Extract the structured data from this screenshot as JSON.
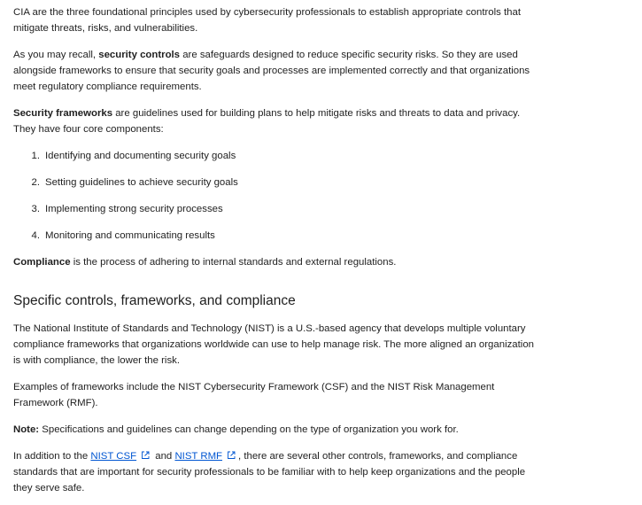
{
  "intro": {
    "text": "CIA are the three foundational principles used by cybersecurity professionals to establish appropriate controls that mitigate threats, risks, and vulnerabilities."
  },
  "controls": {
    "prefix": "As you may recall, ",
    "term": "security controls",
    "suffix": " are safeguards designed to reduce specific security risks. So they are used alongside frameworks to ensure that security goals and processes are implemented correctly and that organizations meet regulatory compliance requirements."
  },
  "frameworks": {
    "term": "Security frameworks",
    "suffix": " are guidelines used for building plans to help mitigate risks and threats to data and privacy. They have four core components:"
  },
  "core_components": [
    {
      "num": "1.",
      "text": "Identifying and documenting security goals"
    },
    {
      "num": "2.",
      "text": "Setting guidelines to achieve security goals"
    },
    {
      "num": "3.",
      "text": "Implementing strong security processes"
    },
    {
      "num": "4.",
      "text": "Monitoring and communicating results"
    }
  ],
  "compliance": {
    "term": "Compliance",
    "suffix": " is the process of adhering to internal standards and external regulations."
  },
  "section_heading": "Specific controls, frameworks, and compliance",
  "nist_paragraph": "The National Institute of Standards and Technology (NIST) is a U.S.-based agency that develops multiple voluntary compliance frameworks that organizations worldwide can use to help manage risk. The more aligned an organization is with compliance, the lower the risk.",
  "examples_paragraph": "Examples of frameworks include the NIST Cybersecurity Framework (CSF) and the NIST Risk Management Framework (RMF).",
  "note": {
    "label": "Note:",
    "text": " Specifications and guidelines can change depending on the type of organization you work for."
  },
  "addition": {
    "prefix": "In addition to the ",
    "link1": "NIST CSF",
    "middle": " and ",
    "link2": "NIST RMF",
    "suffix": ", there are several other controls, frameworks, and compliance standards that are important for security professionals to be familiar with to help keep organizations and the people they serve safe."
  },
  "colors": {
    "text": "#1f1f1f",
    "link": "#0056d2",
    "background": "#ffffff"
  },
  "icons": {
    "external_link": "external-link-icon"
  }
}
